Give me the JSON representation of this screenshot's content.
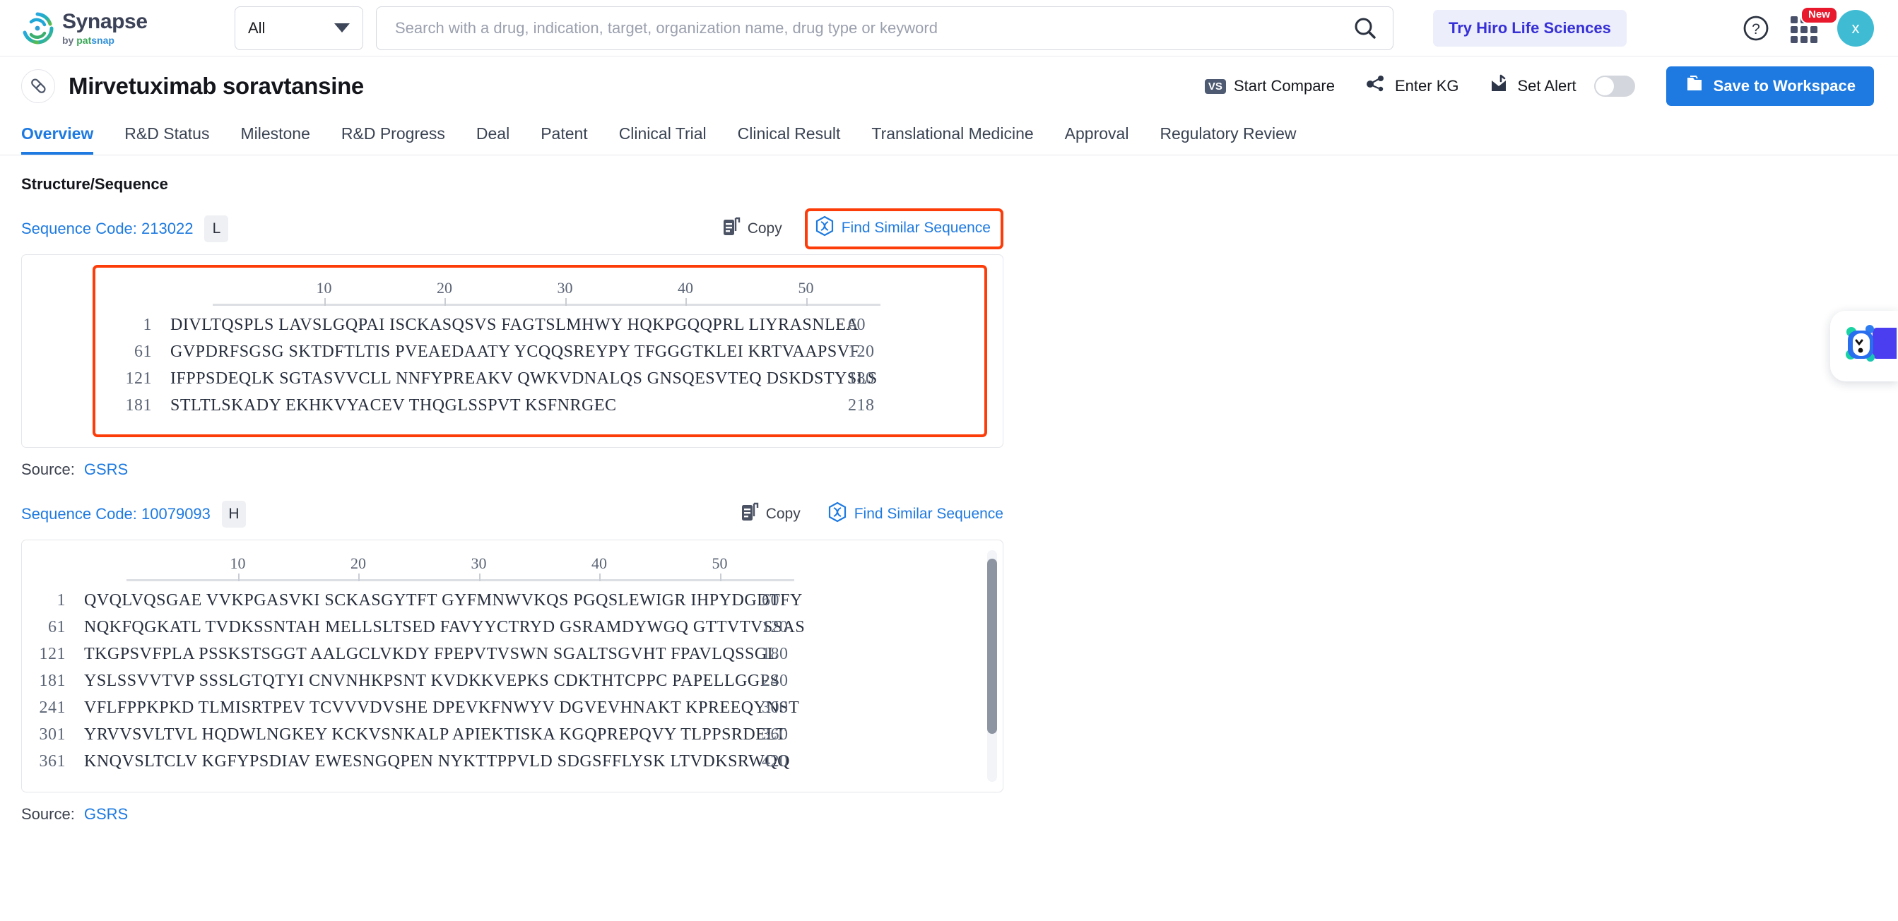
{
  "topbar": {
    "logo_title": "Synapse",
    "logo_sub_prefix": "by ",
    "logo_sub_pat": "pat",
    "logo_sub_snap": "snap",
    "scope_value": "All",
    "search_placeholder": "Search with a drug, indication, target, organization name, drug type or keyword",
    "search_value": "",
    "hiro_label": "Try Hiro Life Sciences",
    "new_badge": "New",
    "avatar_initial": "x",
    "accent_blue": "#1e7ae0",
    "hiro_purple": "#3730d6",
    "badge_red": "#e8192c",
    "avatar_teal": "#3fbcd4"
  },
  "drug": {
    "title": "Mirvetuximab soravtansine",
    "actions": {
      "compare_badge": "VS",
      "compare_label": "Start Compare",
      "kg_label": "Enter KG",
      "alert_label": "Set Alert",
      "alert_on": false,
      "save_label": "Save to Workspace"
    }
  },
  "tabs": [
    {
      "label": "Overview",
      "active": true
    },
    {
      "label": "R&D Status",
      "active": false
    },
    {
      "label": "Milestone",
      "active": false
    },
    {
      "label": "R&D Progress",
      "active": false
    },
    {
      "label": "Deal",
      "active": false
    },
    {
      "label": "Patent",
      "active": false
    },
    {
      "label": "Clinical Trial",
      "active": false
    },
    {
      "label": "Clinical Result",
      "active": false
    },
    {
      "label": "Translational Medicine",
      "active": false
    },
    {
      "label": "Approval",
      "active": false
    },
    {
      "label": "Regulatory Review",
      "active": false
    }
  ],
  "section": {
    "title": "Structure/Sequence",
    "copy_label": "Copy",
    "find_similar_label": "Find Similar Sequence",
    "source_label": "Source:",
    "source_value": "GSRS",
    "ruler_ticks": [
      "10",
      "20",
      "30",
      "40",
      "50"
    ]
  },
  "sequences": [
    {
      "code_label": "Sequence Code: 213022",
      "chain_badge": "L",
      "highlighted": true,
      "rows": [
        {
          "start": "1",
          "blocks": "DIVLTQSPLS LAVSLGQPAI ISCKASQSVS FAGTSLMHWY HQKPGQQPRL LIYRASNLEA",
          "end": "60"
        },
        {
          "start": "61",
          "blocks": "GVPDRFSGSG SKTDFTLTIS PVEAEDAATY YCQQSREYPY TFGGGTKLEI KRTVAAPSVF",
          "end": "120"
        },
        {
          "start": "121",
          "blocks": "IFPPSDEQLK SGTASVVCLL NNFYPREAKV QWKVDNALQS GNSQESVTEQ DSKDSTYSLS",
          "end": "180"
        },
        {
          "start": "181",
          "blocks": "STLTLSKADY EKHKVYACEV THQGLSSPVT KSFNRGEC",
          "end": "218"
        }
      ]
    },
    {
      "code_label": "Sequence Code: 10079093",
      "chain_badge": "H",
      "highlighted": false,
      "rows": [
        {
          "start": "1",
          "blocks": "QVQLVQSGAE VVKPGASVKI SCKASGYTFT GYFMNWVKQS PGQSLEWIGR IHPYDGDTFY",
          "end": "60"
        },
        {
          "start": "61",
          "blocks": "NQKFQGKATL TVDKSSNTAH MELLSLTSED FAVYYCTRYD GSRAMDYWGQ GTTVTVSSAS",
          "end": "120"
        },
        {
          "start": "121",
          "blocks": "TKGPSVFPLA PSSKSTSGGT AALGCLVKDY FPEPVTVSWN SGALTSGVHT FPAVLQSSGL",
          "end": "180"
        },
        {
          "start": "181",
          "blocks": "YSLSSVVTVP SSSLGTQTYI CNVNHKPSNT KVDKKVEPKS CDKTHTCPPC PAPELLGGPS",
          "end": "240"
        },
        {
          "start": "241",
          "blocks": "VFLFPPKPKD TLMISRTPEV TCVVVDVSHE DPEVKFNWYV DGVEVHNAKT KPREEQYNST",
          "end": "300"
        },
        {
          "start": "301",
          "blocks": "YRVVSVLTVL HQDWLNGKEY KCKVSNKALP APIEKTISKA KGQPREPQVY TLPPSRDELT",
          "end": "360"
        },
        {
          "start": "361",
          "blocks": "KNQVSLTCLV KGFYPSDIAV EWESNGQPEN NYKTTPPVLD SDGSFFLYSK LTVDKSRWQQ",
          "end": "420"
        }
      ]
    }
  ]
}
